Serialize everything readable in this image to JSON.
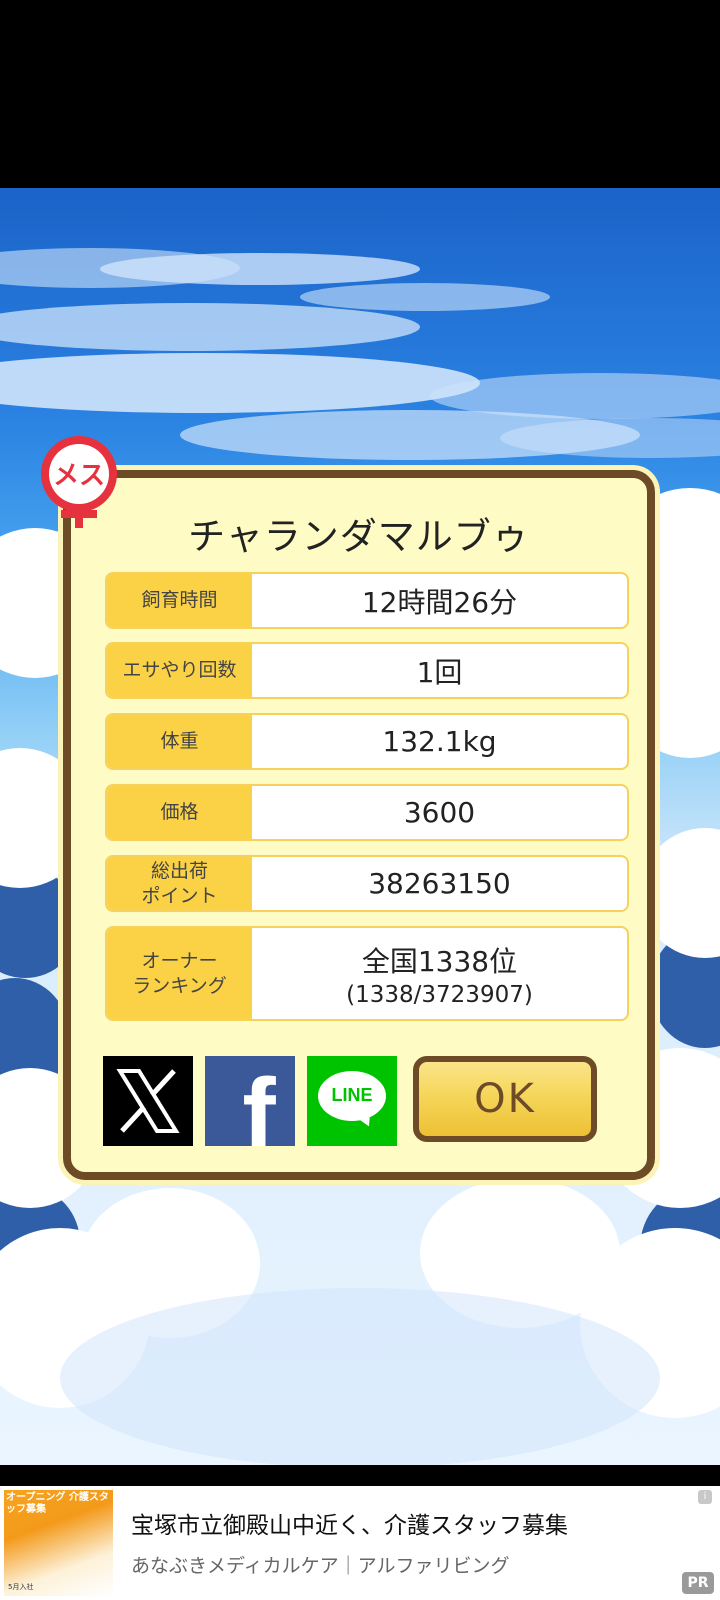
{
  "pig_card": {
    "name": "チャランダマルブゥ",
    "gender_badge": "メス",
    "stats": [
      {
        "label": "飼育時間",
        "value": "12時間26分"
      },
      {
        "label": "エサやり回数",
        "value": "1回"
      },
      {
        "label": "体重",
        "value": "132.1kg"
      },
      {
        "label": "価格",
        "value": "3600"
      },
      {
        "label_line1": "総出荷",
        "label_line2": "ポイント",
        "value": "38263150"
      },
      {
        "label_line1": "オーナー",
        "label_line2": "ランキング",
        "value": "全国1338位",
        "sub_value": "(1338/3723907)"
      }
    ],
    "share_buttons": {
      "x": "X",
      "facebook": "f",
      "line": "LINE"
    },
    "ok_label": "OK"
  },
  "ad": {
    "image_title": "オープニング 介護スタッフ募集",
    "image_caption": "5月入社",
    "title": "宝塚市立御殿山中近く、介護スタッフ募集",
    "description": "あなぶきメディカルケア｜アルファリビング",
    "info_icon": "i",
    "pr_label": "PR"
  },
  "colors": {
    "dialog_bg": "#fefcc4",
    "dialog_border": "#6d4b27",
    "label_bg": "#fbd246",
    "gender_red": "#e6323e",
    "facebook": "#3b5998",
    "line": "#00c300"
  }
}
